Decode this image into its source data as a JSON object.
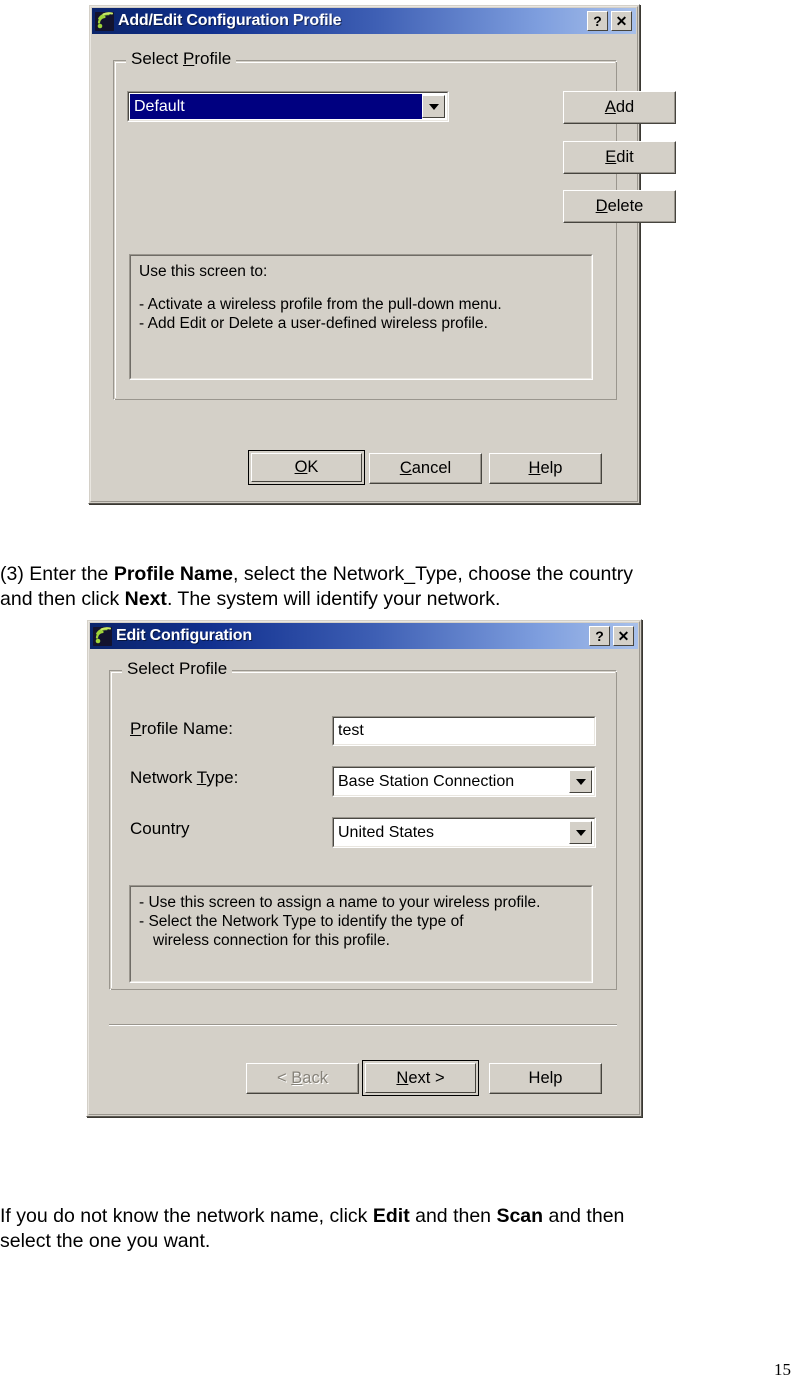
{
  "page": {
    "number": "15"
  },
  "dialog1": {
    "title": "Add/Edit Configuration Profile",
    "icon": "wireless-signal-icon",
    "help_button": "?",
    "close_button": "✕",
    "group_title": "Select Profile",
    "profile_combo": {
      "value": "Default",
      "options": [
        "Default"
      ]
    },
    "buttons": {
      "add": "Add",
      "add_accel": "A",
      "edit": "Edit",
      "edit_accel": "E",
      "delete": "Delete",
      "delete_accel": "D"
    },
    "info": {
      "heading": "Use this screen to:",
      "lines": [
        "-  Activate a wireless profile from the pull-down menu.",
        "-  Add Edit or Delete a user-defined wireless profile."
      ]
    },
    "footer": {
      "ok": "OK",
      "ok_accel": "O",
      "cancel": "Cancel",
      "cancel_accel": "C",
      "help": "Help",
      "help_accel": "H"
    }
  },
  "body_text_1": {
    "line1_pre": "(3) Enter the ",
    "line1_bold": "Profile Name",
    "line1_post": ", select the Network_Type, choose the country",
    "line2_pre": "and then click ",
    "line2_bold": "Next",
    "line2_post": ". The system will identify your network."
  },
  "dialog2": {
    "title": "Edit Configuration",
    "icon": "wireless-signal-icon",
    "help_button": "?",
    "close_button": "✕",
    "group_title": "Select Profile",
    "fields": {
      "profile_name_label": "Profile Name:",
      "profile_name_accel": "P",
      "profile_name_value": "test",
      "network_type_label": "Network Type:",
      "network_type_accel": "T",
      "network_type_value": "Base Station Connection",
      "country_label": "Country",
      "country_value": "United States"
    },
    "info": {
      "lines": [
        "-  Use this screen to assign a name to your wireless profile.",
        "-  Select the Network Type to identify the type of",
        "wireless connection for this profile."
      ]
    },
    "footer": {
      "back": "< Back",
      "back_accel": "B",
      "next": "Next >",
      "next_accel": "N",
      "help": "Help"
    }
  },
  "body_text_2": {
    "line1_pre": "If you do not know the network name, click ",
    "line1_bold1": "Edit",
    "line1_mid": " and then ",
    "line1_bold2": "Scan",
    "line1_post": " and then",
    "line2": "select the one you want."
  },
  "colors": {
    "dialog_face": "#d4d0c8",
    "title_dark": "#0a246a",
    "title_light": "#a8c0ea",
    "selection": "#000080",
    "disabled_text": "#868279"
  }
}
